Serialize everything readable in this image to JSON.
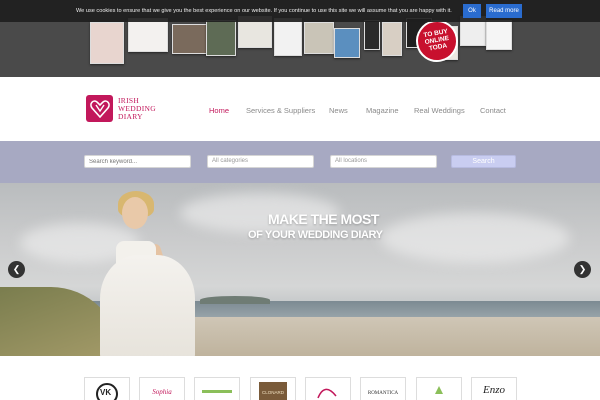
{
  "cookie": {
    "text": "We use cookies to ensure that we give you the best experience on our website. If you continue to use this site we will assume that you are happy with it.",
    "ok_label": "Ok",
    "read_more_label": "Read more"
  },
  "banner": {
    "badge_lines": [
      "TO BUY",
      "ONLINE",
      "TODA"
    ]
  },
  "brand": {
    "line1": "IRISH",
    "line2": "WEDDING",
    "line3": "DIARY",
    "color": "#c2185b"
  },
  "nav": {
    "items": [
      {
        "label": "Home",
        "active": true
      },
      {
        "label": "Services & Suppliers",
        "active": false
      },
      {
        "label": "News",
        "active": false
      },
      {
        "label": "Magazine",
        "active": false
      },
      {
        "label": "Real Weddings",
        "active": false
      },
      {
        "label": "Contact",
        "active": false
      }
    ]
  },
  "search": {
    "keyword_placeholder": "Search keyword...",
    "categories_value": "All categories",
    "locations_value": "All locations",
    "button_label": "Search"
  },
  "hero": {
    "line1": "MAKE THE MOST",
    "line2": "OF YOUR WEDDING DIARY",
    "prev_icon": "chevron-left-icon",
    "next_icon": "chevron-right-icon"
  },
  "partners": [
    {
      "label": "VK"
    },
    {
      "label": "Sophia"
    },
    {
      "label": ""
    },
    {
      "label": "CLONARD"
    },
    {
      "label": ""
    },
    {
      "label": "ROMANTICA"
    },
    {
      "label": ""
    },
    {
      "label": "Enzo"
    }
  ]
}
